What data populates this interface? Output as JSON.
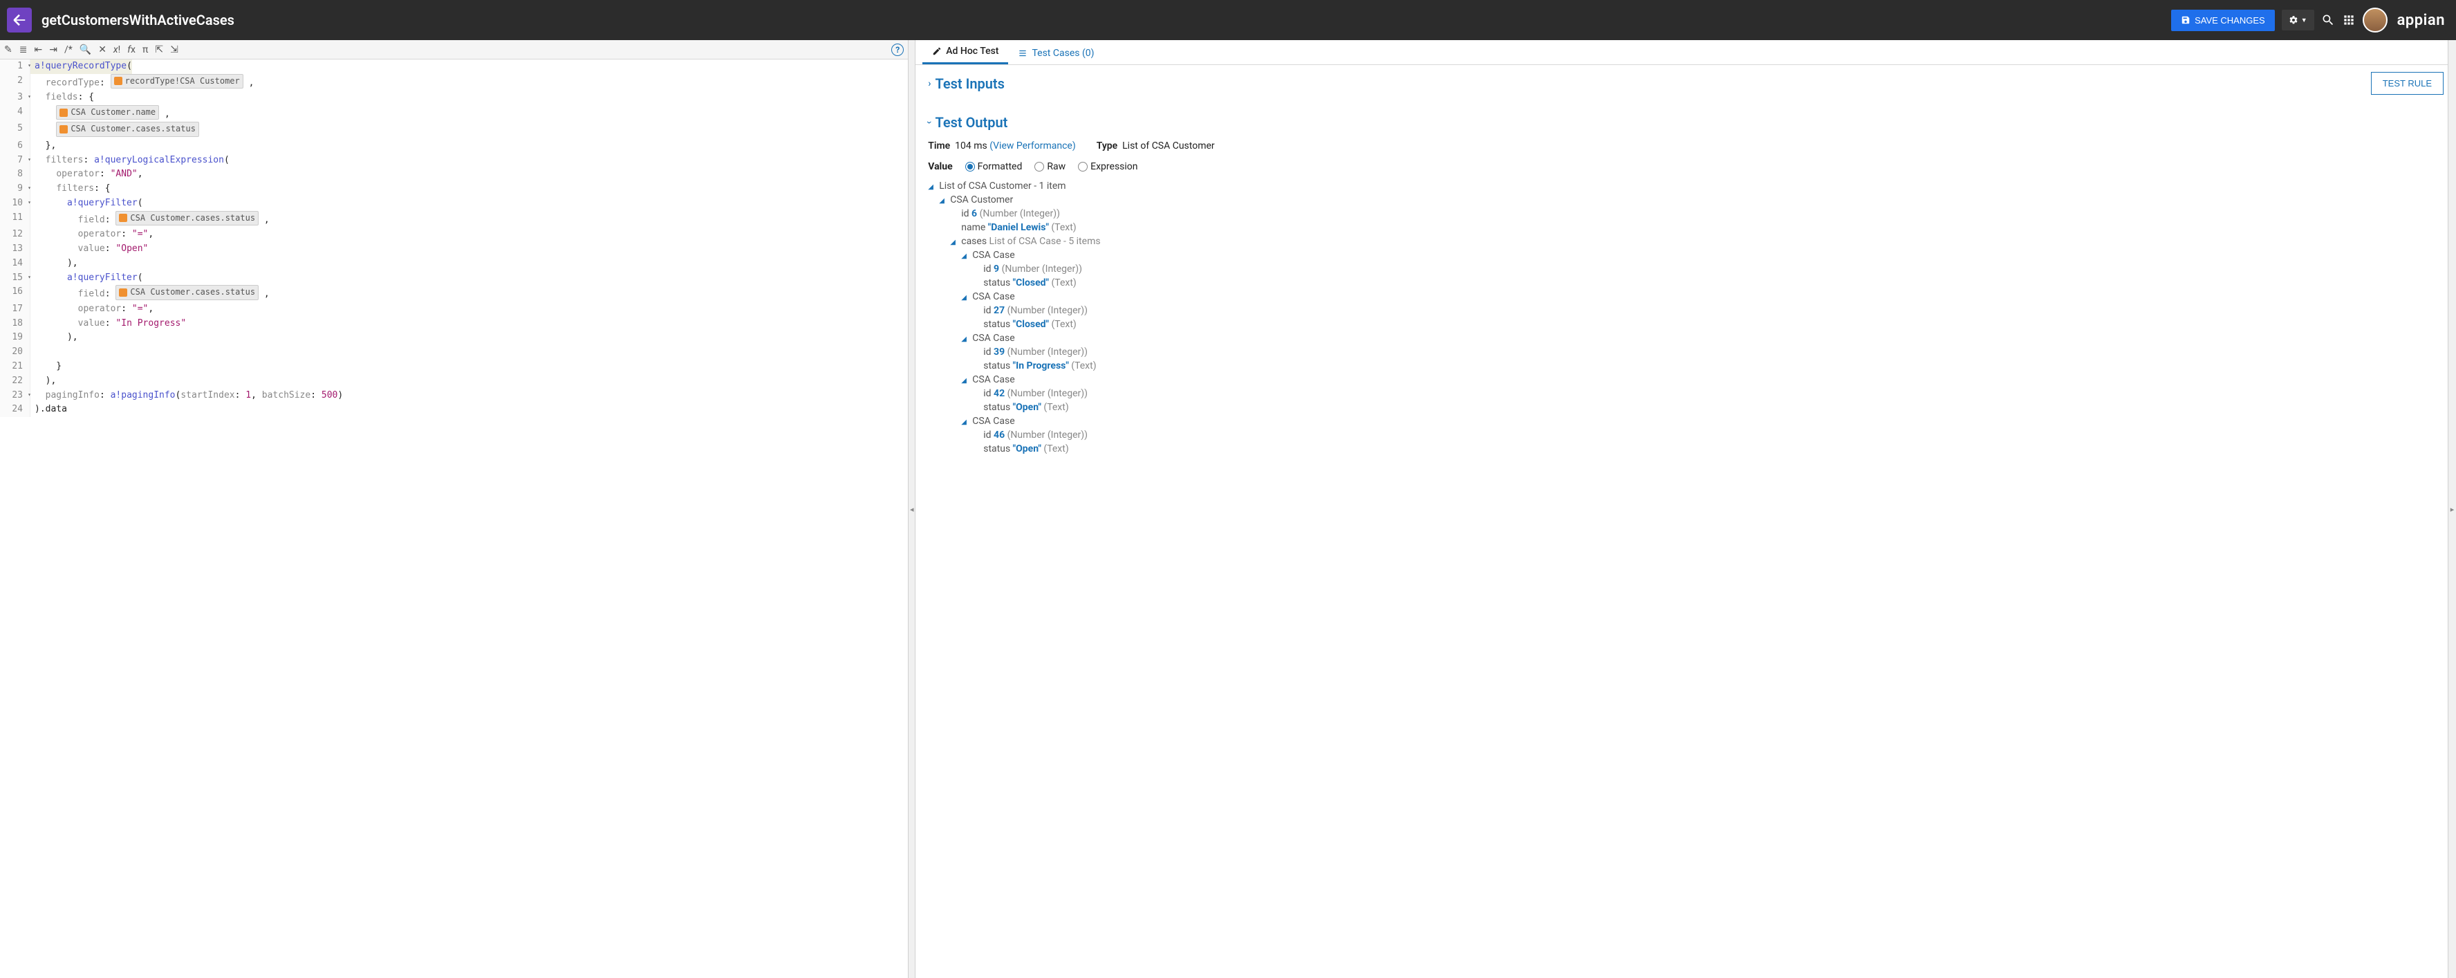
{
  "header": {
    "title": "getCustomersWithActiveCases",
    "save_label": "SAVE CHANGES",
    "brand": "appian"
  },
  "tabs": {
    "adhoc": "Ad Hoc Test",
    "testcases": "Test Cases (0)"
  },
  "sections": {
    "inputs": "Test Inputs",
    "output": "Test Output",
    "test_rule_btn": "TEST RULE"
  },
  "meta": {
    "time_label": "Time",
    "time_value": "104 ms",
    "view_perf": "(View Performance)",
    "type_label": "Type",
    "type_value": "List of CSA Customer"
  },
  "value": {
    "label": "Value",
    "opt_formatted": "Formatted",
    "opt_raw": "Raw",
    "opt_expr": "Expression"
  },
  "code": {
    "lines": [
      "a!queryRecordType(",
      "  recordType: ",
      "  fields: {",
      "    ",
      "    ",
      "  },",
      "  filters: a!queryLogicalExpression(",
      "    operator: \"AND\",",
      "    filters: {",
      "      a!queryFilter(",
      "        field: ",
      "        operator: \"=\",",
      "        value: \"Open\"",
      "      ),",
      "      a!queryFilter(",
      "        field: ",
      "        operator: \"=\",",
      "        value: \"In Progress\"",
      "      ),",
      "",
      "    }",
      "  ),",
      "  pagingInfo: a!pagingInfo(startIndex: 1, batchSize: 500)",
      ").data"
    ],
    "chips": {
      "recordType": "recordType!CSA Customer",
      "field_name": "CSA Customer.name",
      "field_status": "CSA Customer.cases.status"
    }
  },
  "tree": {
    "root": "List of CSA Customer - 1 item",
    "customer": "CSA Customer",
    "id_label": "id",
    "name_label": "name",
    "cases_label": "cases",
    "status_label": "status",
    "num_type": "(Number (Integer))",
    "text_type": "(Text)",
    "cust_id": "6",
    "cust_name": "\"Daniel Lewis\"",
    "cases_summary": "List of CSA Case - 5 items",
    "case_label": "CSA Case",
    "cases": [
      {
        "id": "9",
        "status": "\"Closed\""
      },
      {
        "id": "27",
        "status": "\"Closed\""
      },
      {
        "id": "39",
        "status": "\"In Progress\""
      },
      {
        "id": "42",
        "status": "\"Open\""
      },
      {
        "id": "46",
        "status": "\"Open\""
      }
    ]
  }
}
